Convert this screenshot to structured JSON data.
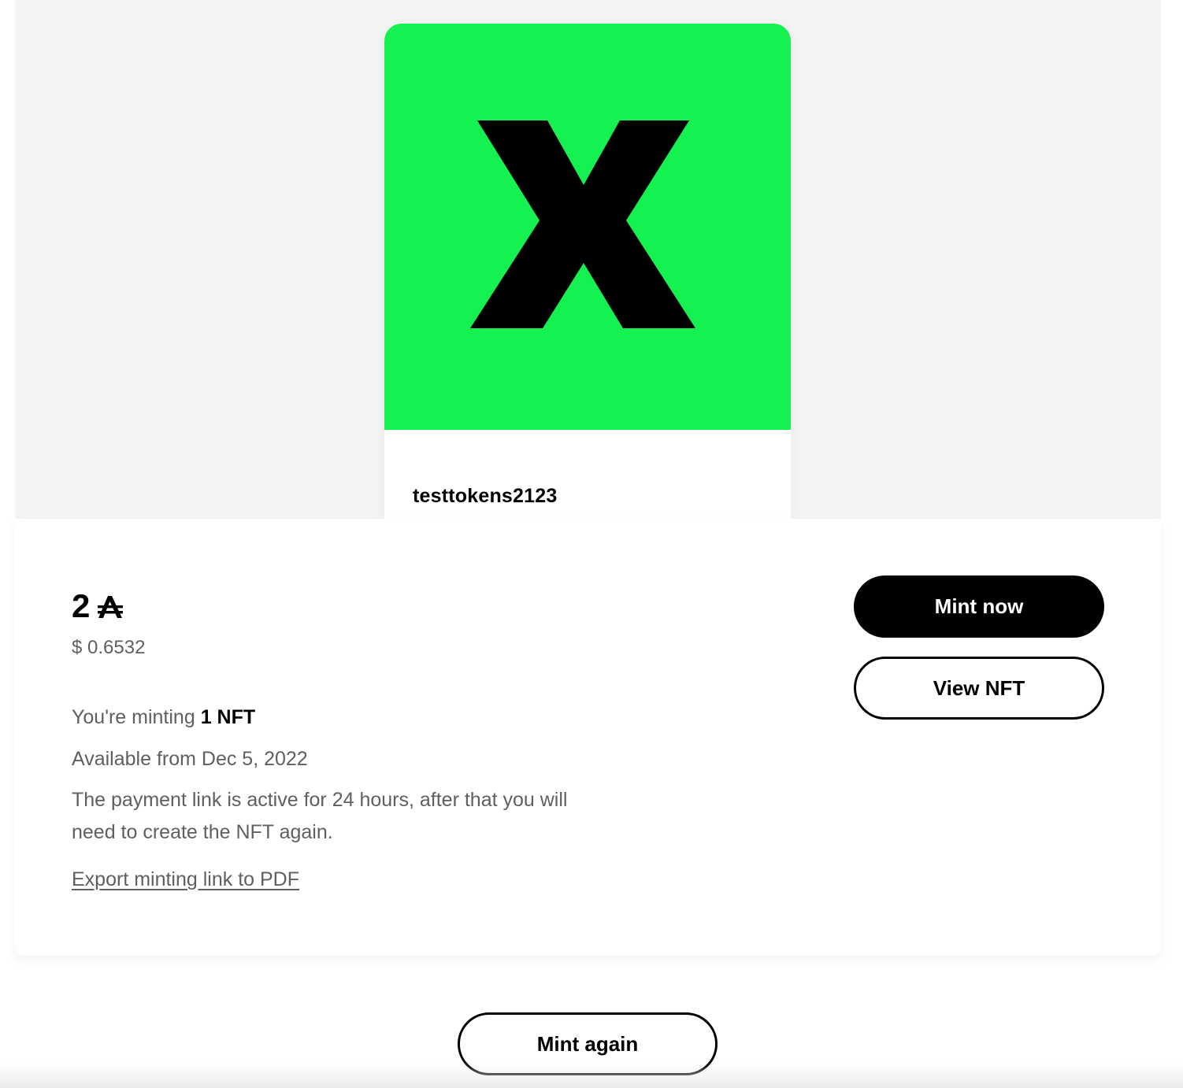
{
  "nft": {
    "name": "testtokens2123",
    "art_background": "#14f150",
    "art_glyph_color": "#000000",
    "art_icon": "x-logo-icon"
  },
  "price": {
    "amount": "2",
    "currency_icon": "algorand-icon",
    "usd": "$ 0.6532"
  },
  "minting": {
    "prefix": "You're minting",
    "count": "1 NFT",
    "available": "Available from Dec 5, 2022",
    "payment_note": "The payment link is active for 24 hours, after that you will need to create the NFT again.",
    "export_link": "Export minting link to PDF"
  },
  "actions": {
    "mint_now": "Mint now",
    "view_nft": "View NFT",
    "mint_again": "Mint again"
  }
}
